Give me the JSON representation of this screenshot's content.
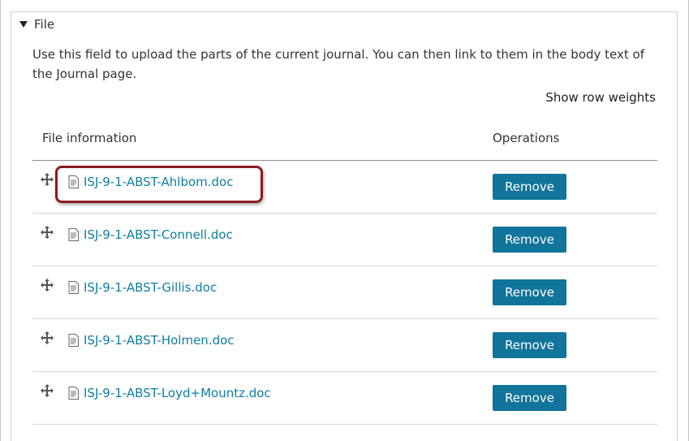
{
  "fieldset": {
    "legend": "File",
    "description": "Use this field to upload the parts of the current journal. You can then link to them in the body text of the Journal page.",
    "row_weights_label": "Show row weights"
  },
  "table": {
    "headers": [
      "File information",
      "Operations"
    ],
    "rows": [
      {
        "filename": "ISJ-9-1-ABST-Ahlbom.doc",
        "action": "Remove"
      },
      {
        "filename": "ISJ-9-1-ABST-Connell.doc",
        "action": "Remove"
      },
      {
        "filename": "ISJ-9-1-ABST-Gillis.doc",
        "action": "Remove"
      },
      {
        "filename": "ISJ-9-1-ABST-Holmen.doc",
        "action": "Remove"
      },
      {
        "filename": "ISJ-9-1-ABST-Loyd+Mountz.doc",
        "action": "Remove"
      }
    ]
  },
  "icons": {
    "drag": "move-arrows-icon",
    "file": "document-icon",
    "toggle": "triangle-down-icon"
  },
  "colors": {
    "link": "#0f7ea0",
    "button": "#11749a",
    "highlight": "#8b1a1f"
  }
}
